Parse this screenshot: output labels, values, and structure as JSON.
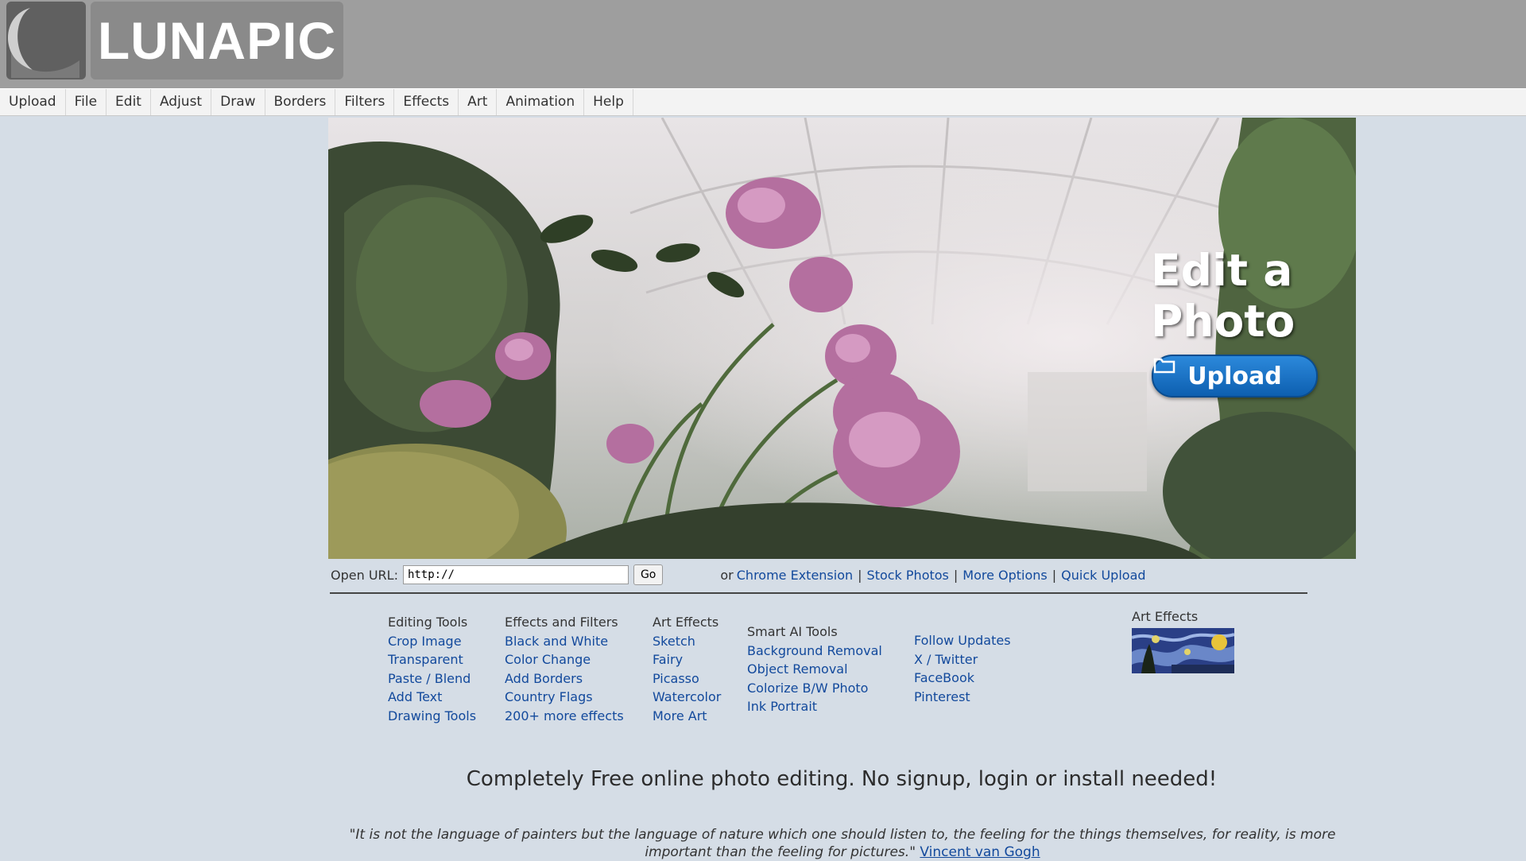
{
  "brand": {
    "name": "LUNAPIC"
  },
  "menu": [
    "Upload",
    "File",
    "Edit",
    "Adjust",
    "Draw",
    "Borders",
    "Filters",
    "Effects",
    "Art",
    "Animation",
    "Help"
  ],
  "hero": {
    "title": "Edit a Photo",
    "upload_label": "Upload"
  },
  "url_bar": {
    "label": "Open URL:",
    "input_value": "http://",
    "go_label": "Go",
    "or_text": "or",
    "links": [
      "Chrome Extension",
      "Stock Photos",
      "More Options",
      "Quick Upload"
    ]
  },
  "columns": [
    {
      "heading": "Editing Tools",
      "links": [
        "Crop Image",
        "Transparent",
        "Paste / Blend",
        "Add Text",
        "Drawing Tools"
      ]
    },
    {
      "heading": "Effects and Filters",
      "links": [
        "Black and White",
        "Color Change",
        "Add Borders",
        "Country Flags",
        "200+ more effects"
      ]
    },
    {
      "heading": "Art Effects",
      "links": [
        "Sketch",
        "Fairy",
        "Picasso",
        "Watercolor",
        "More Art"
      ]
    },
    {
      "heading": "Smart AI Tools",
      "links": [
        "Background Removal",
        "Object Removal",
        "Colorize B/W Photo",
        "Ink Portrait"
      ]
    },
    {
      "heading": "",
      "links": [
        "Follow Updates",
        "X / Twitter",
        "FaceBook",
        "Pinterest"
      ]
    }
  ],
  "art_thumbnail": {
    "label": "Art Effects"
  },
  "tagline": "Completely Free online photo editing. No signup, login or install needed!",
  "quote": {
    "text": "\"It is not the language of painters but the language of nature which one should listen to, the feeling for the things themselves, for reality, is more important than the feeling for pictures.\"",
    "author": "Vincent van Gogh"
  },
  "colors": {
    "link": "#12499c",
    "upload_button": "#1a6fc4",
    "header": "#9e9e9e",
    "page_bg": "#d5dde6"
  }
}
